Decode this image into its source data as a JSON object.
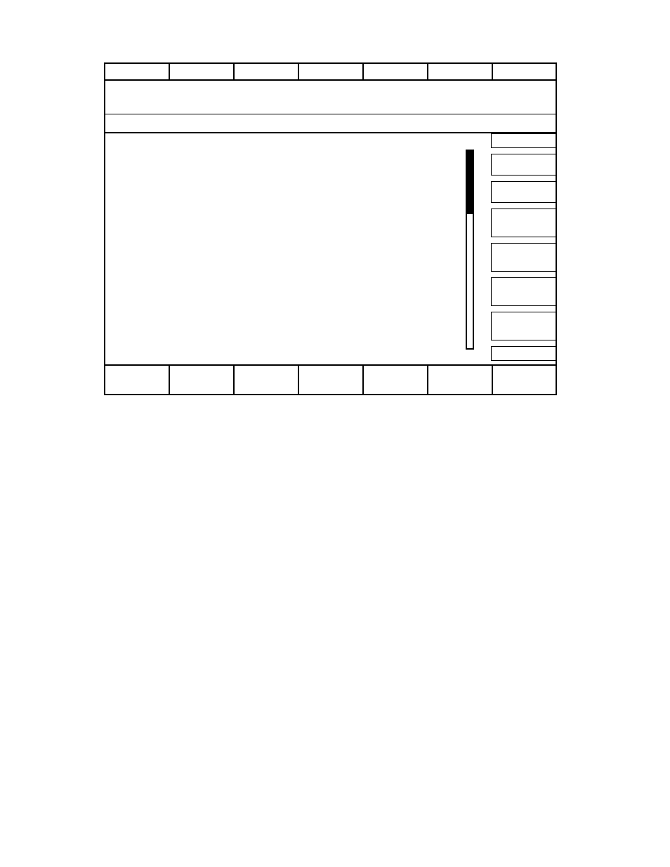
{
  "top_keys": [
    {
      "kind": "key"
    },
    {
      "kind": "key"
    },
    {
      "kind": "key"
    },
    {
      "kind": "key"
    },
    {
      "kind": "key"
    },
    {
      "kind": "key"
    },
    {
      "kind": "key"
    }
  ],
  "side_keys": [
    {
      "kind": "slim"
    },
    {
      "kind": "short"
    },
    {
      "kind": "short"
    },
    {
      "kind": "tall"
    },
    {
      "kind": "tall"
    },
    {
      "kind": "tall"
    },
    {
      "kind": "tall"
    },
    {
      "kind": "slim"
    }
  ],
  "bottom_keys": [
    {
      "kind": "key"
    },
    {
      "kind": "key"
    },
    {
      "kind": "key"
    },
    {
      "kind": "key"
    },
    {
      "kind": "key"
    },
    {
      "kind": "key"
    },
    {
      "kind": "key"
    }
  ]
}
